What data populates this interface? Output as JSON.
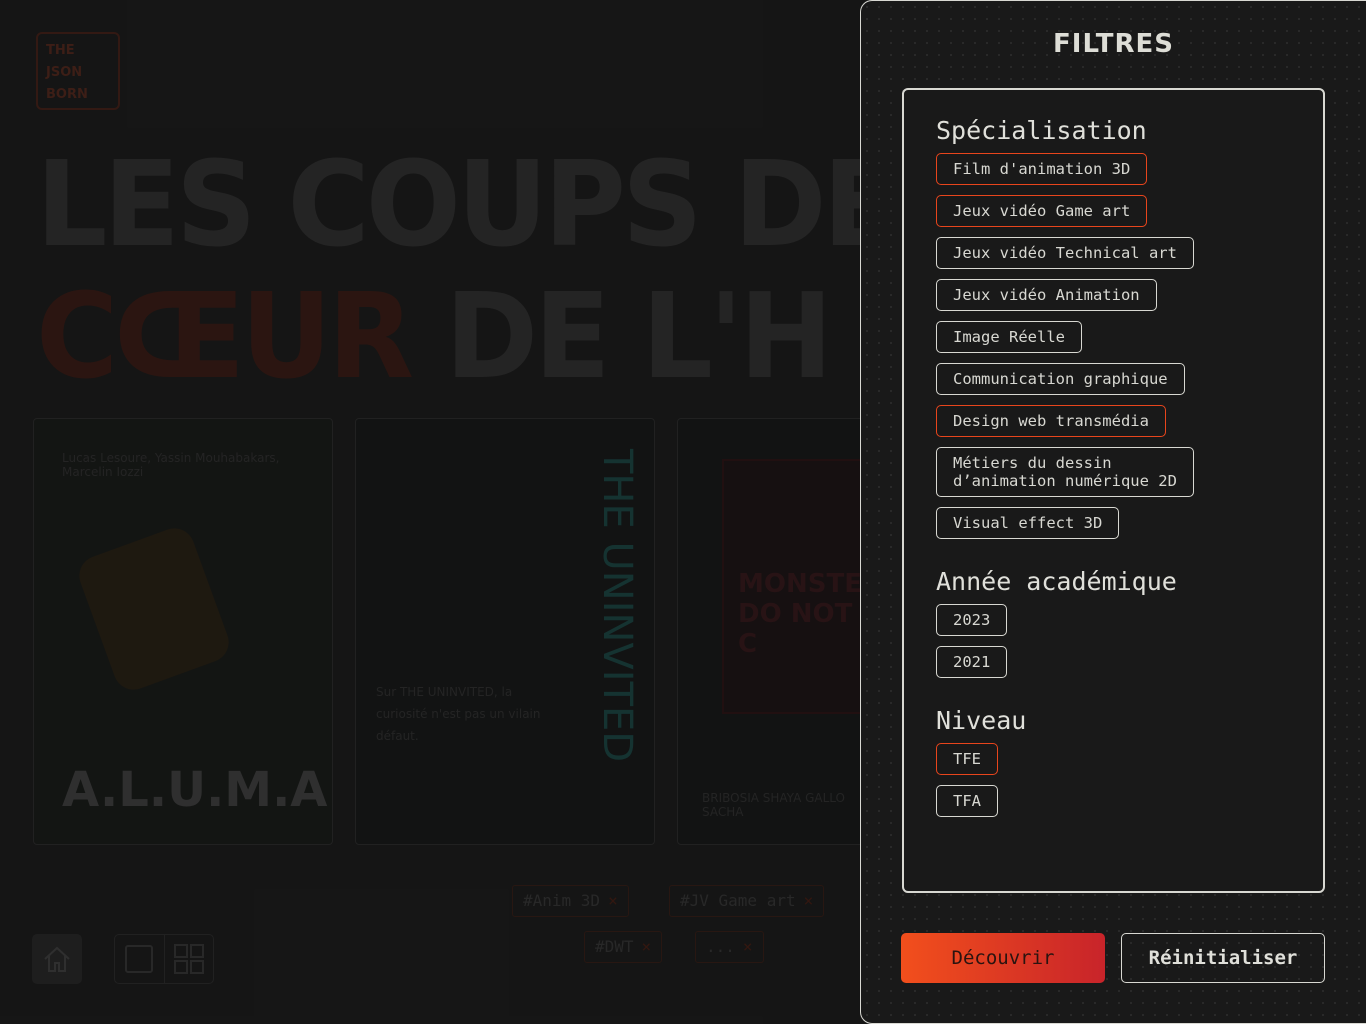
{
  "background": {
    "logo_text": [
      "THE",
      "JSON",
      "BORN"
    ],
    "headline_line1": "LES COUPS DE",
    "headline_line2_accent": "CŒUR",
    "headline_line2_rest": "DE L'H",
    "cards": [
      {
        "title": "A.L.U.M.A",
        "credits": "Lucas Lesoure, Yassin Mouhabakars, Marcelin Iozzi"
      },
      {
        "title": "THE UNINVITED",
        "tagline": "Sur THE UNINVITED, la curiosité n'est pas un vilain défaut."
      },
      {
        "title": "MONSTERS DO NOT C",
        "credits": "BRIBOSIA SHAYA   GALLO SACHA"
      }
    ],
    "active_tags": [
      {
        "label": "#Anim 3D",
        "remove": "×"
      },
      {
        "label": "#JV Game art",
        "remove": "×"
      },
      {
        "label": "#DWT",
        "remove": "×"
      },
      {
        "label": "...",
        "remove": "×"
      }
    ],
    "icons": [
      "home-icon",
      "single-view-icon",
      "grid-view-icon"
    ]
  },
  "filters": {
    "title": "FILTRES",
    "accent_color": "#e8451c",
    "specialisation": {
      "label": "Spécialisation",
      "options": [
        {
          "label": "Film d'animation 3D",
          "selected": true
        },
        {
          "label": "Jeux vidéo Game art",
          "selected": true
        },
        {
          "label": "Jeux vidéo Technical art",
          "selected": false
        },
        {
          "label": "Jeux vidéo Animation",
          "selected": false
        },
        {
          "label": "Image Réelle",
          "selected": false
        },
        {
          "label": "Communication graphique",
          "selected": false
        },
        {
          "label": "Design web transmédia",
          "selected": true
        },
        {
          "label": "Métiers du dessin\nd’animation numérique 2D",
          "selected": false
        },
        {
          "label": "Visual effect 3D",
          "selected": false
        }
      ]
    },
    "annee": {
      "label": "Année académique",
      "options": [
        {
          "label": "2023",
          "selected": false
        },
        {
          "label": "2021",
          "selected": false
        }
      ]
    },
    "niveau": {
      "label": "Niveau",
      "options": [
        {
          "label": "TFE",
          "selected": true
        },
        {
          "label": "TFA",
          "selected": false
        }
      ]
    },
    "discover_label": "Découvrir",
    "reset_label": "Réinitialiser"
  }
}
